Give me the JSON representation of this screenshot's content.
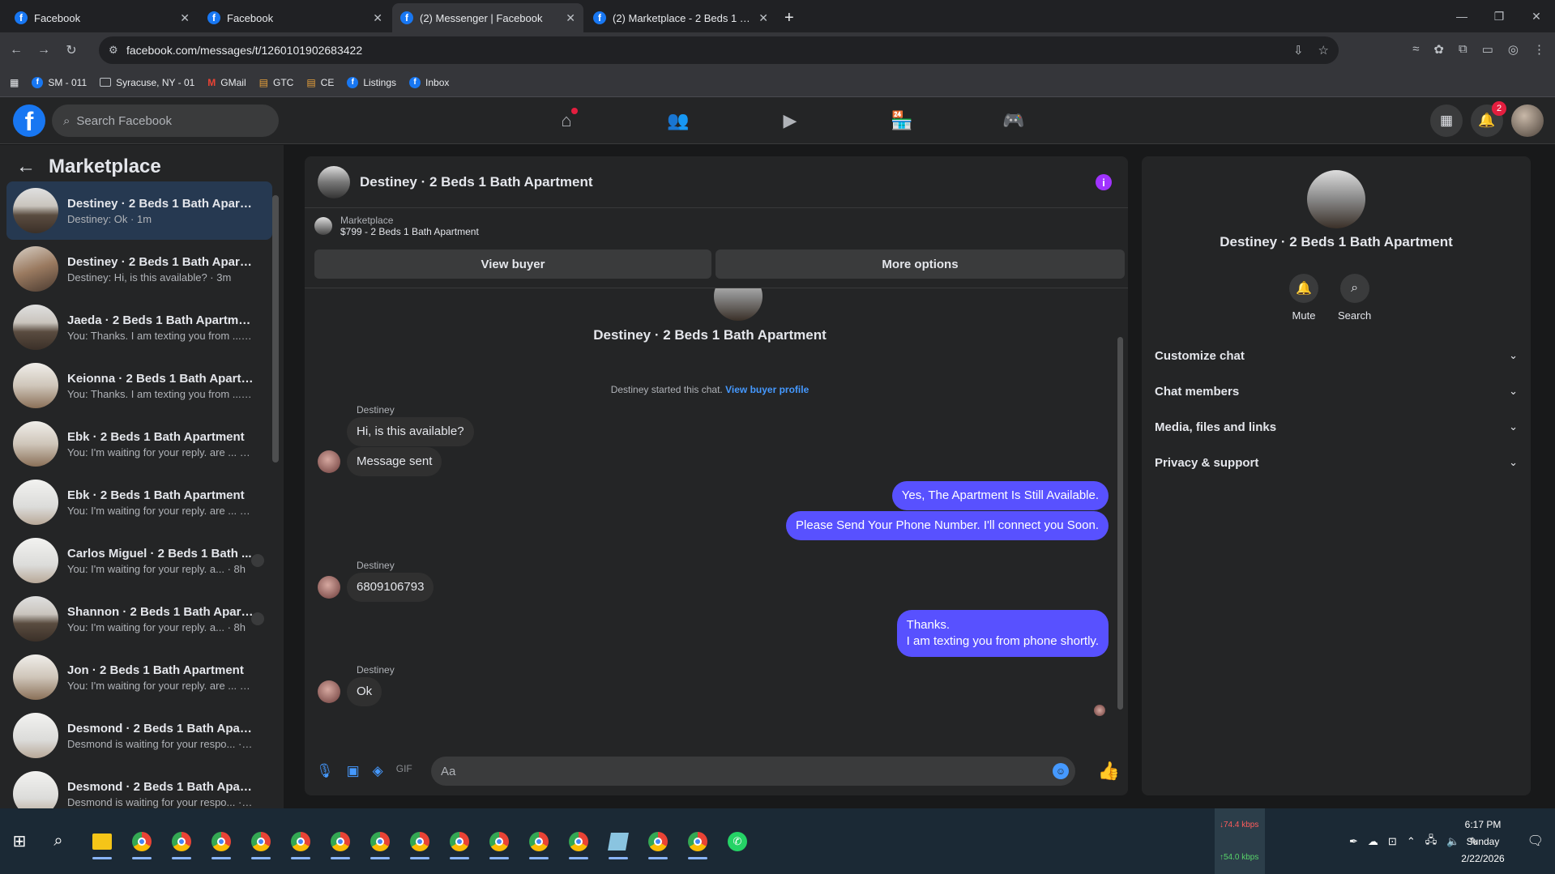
{
  "browser": {
    "tabs": [
      {
        "title": "Facebook"
      },
      {
        "title": "Facebook"
      },
      {
        "title": "(2) Messenger | Facebook"
      },
      {
        "title": "(2) Marketplace - 2 Beds 1 Bath"
      }
    ],
    "url": "facebook.com/messages/t/1260101902683422",
    "bookmarks": [
      "SM - 011",
      "Syracuse, NY - 01",
      "GMail",
      "GTC",
      "CE",
      "Listings",
      "Inbox"
    ]
  },
  "facebook": {
    "search_placeholder": "Search Facebook",
    "notifications_count": "2"
  },
  "sidebar": {
    "title": "Marketplace",
    "conversations": [
      {
        "name": "Destiney · 2 Beds 1 Bath Apartm...",
        "preview": "Destiney: Ok · 1m",
        "thumb": "t1"
      },
      {
        "name": "Destiney · 2 Beds 1 Bath Apartm...",
        "preview": "Destiney: Hi, is this available? · 3m",
        "thumb": "t2"
      },
      {
        "name": "Jaeda · 2 Beds 1 Bath Apartment",
        "preview": "You: Thanks. I am texting you from ... · 3h",
        "thumb": "t1"
      },
      {
        "name": "Keionna · 2 Beds 1 Bath Apartm...",
        "preview": "You: Thanks. I am texting you from ... · 6h",
        "thumb": "t3"
      },
      {
        "name": "Ebk · 2 Beds 1 Bath Apartment",
        "preview": "You: I'm waiting for your reply. are ... · 8h",
        "thumb": "t3"
      },
      {
        "name": "Ebk · 2 Beds 1 Bath Apartment",
        "preview": "You: I'm waiting for your reply. are ... · 8h",
        "thumb": "t4"
      },
      {
        "name": "Carlos Miguel · 2 Beds 1 Bath ...",
        "preview": "You: I'm waiting for your reply. a... · 8h",
        "thumb": "t4"
      },
      {
        "name": "Shannon · 2 Beds 1 Bath Apart...",
        "preview": "You: I'm waiting for your reply. a... · 8h",
        "thumb": "t1"
      },
      {
        "name": "Jon · 2 Beds 1 Bath Apartment",
        "preview": "You: I'm waiting for your reply. are ... · 8h",
        "thumb": "t3"
      },
      {
        "name": "Desmond · 2 Beds 1 Bath Apart...",
        "preview": "Desmond is waiting for your respo... · 9h",
        "thumb": "t4"
      },
      {
        "name": "Desmond · 2 Beds 1 Bath Apart...",
        "preview": "Desmond is waiting for your respo... · 9h",
        "thumb": "t4"
      }
    ]
  },
  "chat": {
    "title": "Destiney · 2 Beds 1 Bath Apartment",
    "listing_source": "Marketplace",
    "listing_detail": "$799 - 2 Beds 1 Bath Apartment",
    "view_buyer": "View buyer",
    "more_options": "More options",
    "started_text": "Destiney started this chat.",
    "view_buyer_profile": "View buyer profile",
    "sender_name": "Destiney",
    "messages": {
      "m1": "Hi, is this available?",
      "m2": "Message sent",
      "m3": "Yes, The Apartment Is Still Available.",
      "m4": "Please Send Your Phone Number. I'll connect you Soon.",
      "m5": "6809106793",
      "m6a": "Thanks.",
      "m6b": "I am texting you from phone shortly.",
      "m7": "Ok"
    },
    "composer_placeholder": "Aa"
  },
  "details": {
    "name": "Destiney · 2 Beds 1 Bath Apartment",
    "mute": "Mute",
    "search": "Search",
    "sections": [
      "Customize chat",
      "Chat members",
      "Media, files and links",
      "Privacy & support"
    ]
  },
  "taskbar": {
    "net_down": "74.4 kbps",
    "net_up": "54.0 kbps",
    "time": "6:17 PM",
    "day": "Sunday",
    "date": "2/22/2026"
  }
}
